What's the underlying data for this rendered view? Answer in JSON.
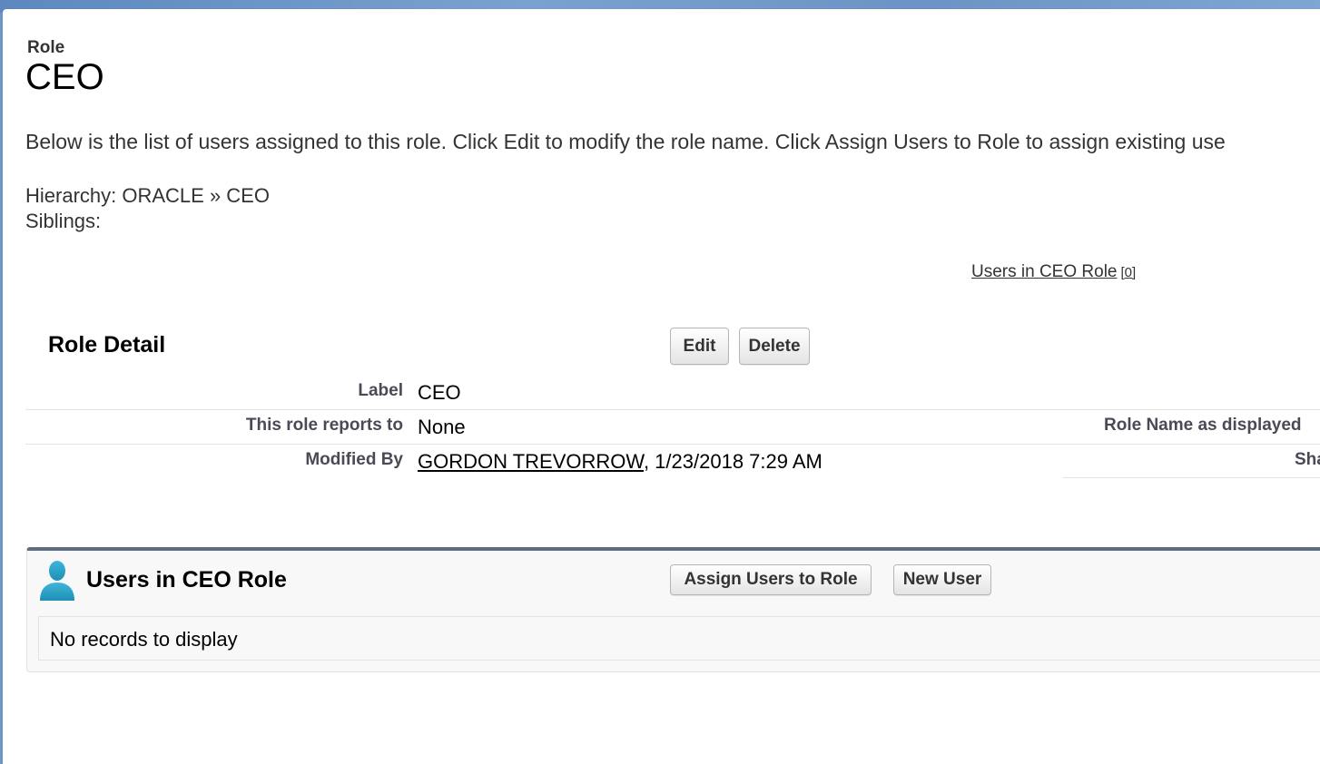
{
  "header": {
    "type_label": "Role",
    "title": "CEO",
    "description": "Below is the list of users assigned to this role. Click Edit to modify the role name. Click Assign Users to Role to assign existing use"
  },
  "hierarchy": {
    "prefix": "Hierarchy: ",
    "text": "ORACLE » CEO",
    "siblings_label": "Siblings:"
  },
  "related_links": {
    "users_link": "Users in CEO Role",
    "users_count": "[0]"
  },
  "role_detail": {
    "section_title": "Role Detail",
    "edit_label": "Edit",
    "delete_label": "Delete",
    "fields": [
      {
        "label": "Label",
        "value": "CEO"
      },
      {
        "label": "This role reports to",
        "value": "None",
        "right_label": "Role Name as displayed"
      },
      {
        "label": "Modified By",
        "value_link": "GORDON TREVORROW",
        "value_suffix": ", 1/23/2018 7:29 AM",
        "right_label": "Shari"
      }
    ]
  },
  "users_section": {
    "title": "Users in CEO Role",
    "icon": "user-icon",
    "assign_label": "Assign Users to Role",
    "new_user_label": "New User",
    "empty_text": "No records to display"
  },
  "colors": {
    "background_band": "#6f97c7",
    "section_border": "#5b6d80",
    "field_label": "#4a4a56"
  }
}
